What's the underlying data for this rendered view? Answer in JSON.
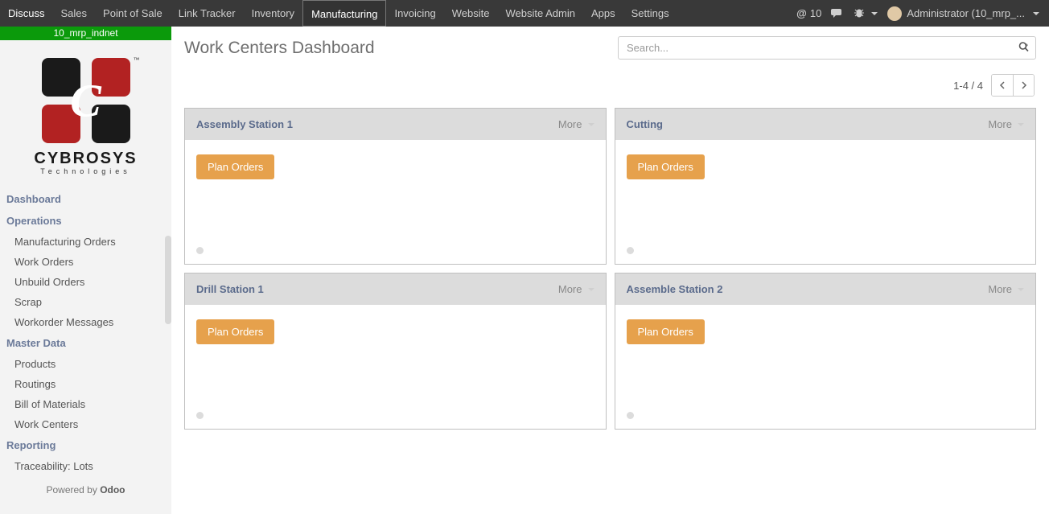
{
  "navbar": {
    "items": [
      "Discuss",
      "Sales",
      "Point of Sale",
      "Link Tracker",
      "Inventory",
      "Manufacturing",
      "Invoicing",
      "Website",
      "Website Admin",
      "Apps",
      "Settings"
    ],
    "active": "Manufacturing",
    "messages_count": "10",
    "user_label": "Administrator (10_mrp_..."
  },
  "db_name": "10_mrp_indnet",
  "logo": {
    "name": "CYBROSYS",
    "sub": "Technologies"
  },
  "sidebar": {
    "groups": [
      {
        "title": "Dashboard",
        "items": []
      },
      {
        "title": "Operations",
        "items": [
          "Manufacturing Orders",
          "Work Orders",
          "Unbuild Orders",
          "Scrap",
          "Workorder Messages"
        ]
      },
      {
        "title": "Master Data",
        "items": [
          "Products",
          "Routings",
          "Bill of Materials",
          "Work Centers"
        ]
      },
      {
        "title": "Reporting",
        "items": [
          "Traceability: Lots"
        ]
      }
    ],
    "powered_prefix": "Powered by ",
    "powered_name": "Odoo"
  },
  "page": {
    "title": "Work Centers Dashboard",
    "search_placeholder": "Search...",
    "pager": "1-4 / 4"
  },
  "more_label": "More",
  "plan_label": "Plan Orders",
  "cards": [
    {
      "title": "Assembly Station 1"
    },
    {
      "title": "Cutting"
    },
    {
      "title": "Drill Station 1"
    },
    {
      "title": "Assemble Station 2"
    }
  ]
}
